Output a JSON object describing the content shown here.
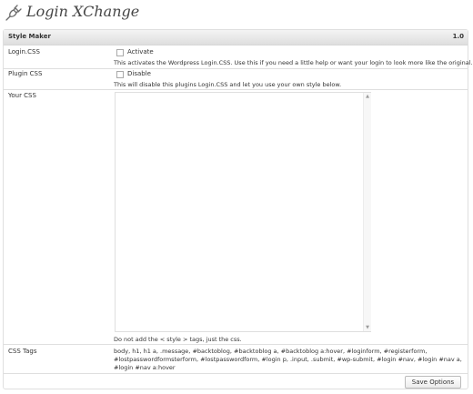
{
  "header": {
    "title": "Login XChange",
    "icon": "plug-icon"
  },
  "panel": {
    "title": "Style Maker",
    "version": "1.0"
  },
  "rows": {
    "login_css": {
      "label": "Login.CSS",
      "checkbox_label": "Activate",
      "checked": false,
      "description": "This activates the Wordpress Login.CSS. Use this if you need a little help or want your login to look more like the original."
    },
    "plugin_css": {
      "label": "Plugin CSS",
      "checkbox_label": "Disable",
      "checked": false,
      "description": "This will disable this plugins Login.CSS and let you use your own style below."
    },
    "your_css": {
      "label": "Your CSS",
      "value": "",
      "hint": "Do not add the < style > tags, just the css."
    },
    "css_tags": {
      "label": "CSS Tags",
      "text": "body, h1, h1 a, .message, #backtoblog, #backtoblog a, #backtoblog a:hover, #loginform, #registerform, #lostpasswordformsterform, #lostpasswordform, #login p, .input, .submit, #wp-submit, #login #nav, #login #nav a, #login #nav a:hover"
    }
  },
  "buttons": {
    "save": "Save Options"
  }
}
